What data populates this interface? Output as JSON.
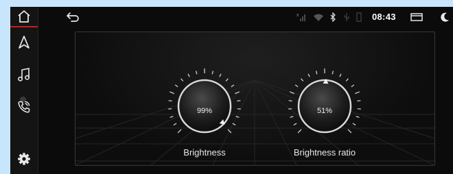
{
  "status_bar": {
    "time": "08:43",
    "icons": [
      "signal-off-icon",
      "wifi-icon",
      "bluetooth-icon",
      "usb-icon",
      "sd-card-icon",
      "window-icon",
      "night-mode-icon"
    ]
  },
  "sidebar": {
    "items": [
      {
        "icon": "home-icon",
        "active": true
      },
      {
        "icon": "navigation-icon"
      },
      {
        "icon": "music-icon"
      },
      {
        "icon": "phone-icon"
      },
      {
        "icon": "settings-icon"
      }
    ],
    "accent_color": "#c81e1e"
  },
  "topbar": {
    "back_icon": "back-arrow-icon"
  },
  "dials": [
    {
      "label": "Brightness",
      "value_text": "99%",
      "value": 99
    },
    {
      "label": "Brightness ratio",
      "value_text": "51%",
      "value": 51
    }
  ]
}
